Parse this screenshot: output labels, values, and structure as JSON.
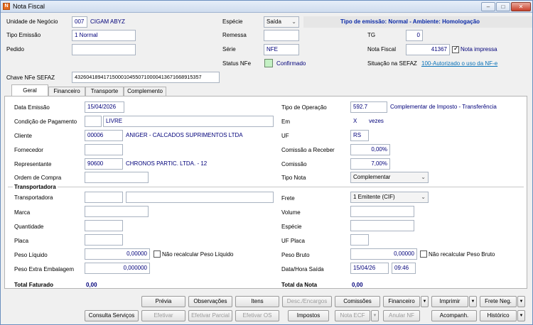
{
  "window": {
    "title": "Nota Fiscal",
    "minimize": "–",
    "maximize": "□",
    "close": "✕",
    "icon_letter": "N"
  },
  "header": {
    "unidade_label": "Unidade de Negócio",
    "unidade_code": "007",
    "unidade_name": "CIGAM ABYZ",
    "especie_label": "Espécie",
    "especie_value": "Saída",
    "tipo_emissao_banner": "Tipo de emissão: Normal - Ambiente: Homologação",
    "tipo_emissao_label": "Tipo Emissão",
    "tipo_emissao_value": "1 Normal",
    "remessa_label": "Remessa",
    "remessa_value": "",
    "tg_label": "TG",
    "tg_value": "0",
    "pedido_label": "Pedido",
    "pedido_value": "",
    "serie_label": "Série",
    "serie_value": "NFE",
    "nota_fiscal_label": "Nota Fiscal",
    "nota_fiscal_value": "41367",
    "nota_impressa_label": "Nota impressa",
    "nota_impressa_checked": true,
    "status_nfe_label": "Status NFe",
    "status_nfe_value": "Confirmado",
    "situacao_label": "Situação na SEFAZ",
    "situacao_value": "100-Autorizado o uso da NF-e",
    "chave_label": "Chave NFe SEFAZ",
    "chave_value": "43260418941715000104550710000413671668915357"
  },
  "tabs": [
    "Geral",
    "Financeiro",
    "Transporte",
    "Complemento"
  ],
  "geral": {
    "data_emissao_label": "Data Emissão",
    "data_emissao_value": "15/04/2026",
    "tipo_operacao_label": "Tipo de Operação",
    "tipo_operacao_code": "592.7",
    "tipo_operacao_desc": "Complementar de Imposto - Transferência",
    "condicao_label": "Condição de Pagamento",
    "condicao_code": "",
    "condicao_value": "LIVRE",
    "em_label": "Em",
    "em_value": "X",
    "vezes_label": "vezes",
    "cliente_label": "Cliente",
    "cliente_code": "00006",
    "cliente_name": "ANIGER - CALCADOS SUPRIMENTOS LTDA",
    "uf_label": "UF",
    "uf_value": "RS",
    "fornecedor_label": "Fornecedor",
    "fornecedor_value": "",
    "comissao_receber_label": "Comissão a Receber",
    "comissao_receber_value": "0,00%",
    "representante_label": "Representante",
    "representante_code": "90600",
    "representante_name": "CHRONOS PARTIC. LTDA. - 12",
    "comissao_label": "Comissão",
    "comissao_value": "7,00%",
    "ordem_compra_label": "Ordem de Compra",
    "ordem_compra_value": "",
    "tipo_nota_label": "Tipo Nota",
    "tipo_nota_value": "Complementar"
  },
  "transportadora": {
    "section_label": "Transportadora",
    "transportadora_label": "Transportadora",
    "transportadora_code": "",
    "transportadora_name": "",
    "frete_label": "Frete",
    "frete_value": "1 Emitente (CIF)",
    "marca_label": "Marca",
    "marca_value": "",
    "volume_label": "Volume",
    "volume_value": "",
    "quantidade_label": "Quantidade",
    "quantidade_value": "",
    "especie_label": "Espécie",
    "especie_value": "",
    "placa_label": "Placa",
    "placa_value": "",
    "uf_placa_label": "UF Placa",
    "uf_placa_value": "",
    "peso_liquido_label": "Peso Líquido",
    "peso_liquido_value": "0,00000",
    "nao_recalc_liq_label": "Não recalcular Peso Líquido",
    "peso_bruto_label": "Peso Bruto",
    "peso_bruto_value": "0,00000",
    "nao_recalc_bruto_label": "Não recalcular Peso Bruto",
    "peso_extra_label": "Peso Extra Embalagem",
    "peso_extra_value": "0,000000",
    "data_hora_saida_label": "Data/Hora Saída",
    "data_saida_value": "15/04/26",
    "hora_saida_value": "09:46"
  },
  "totals": {
    "total_faturado_label": "Total Faturado",
    "total_faturado_value": "0,00",
    "total_nota_label": "Total da Nota",
    "total_nota_value": "0,00"
  },
  "buttons": {
    "previa": "Prévia",
    "observacoes": "Observações",
    "itens": "Itens",
    "desc_encargos": "Desc./Encargos",
    "comissoes": "Comissões",
    "financeiro": "Financeiro",
    "imprimir": "Imprimir",
    "frete_neg": "Frete Neg.",
    "consulta_servicos": "Consulta Serviços",
    "efetivar": "Efetivar",
    "efetivar_parcial": "Efetivar Parcial",
    "efetivar_os": "Efetivar OS",
    "impostos": "Impostos",
    "nota_ecf": "Nota ECF",
    "anular_nf": "Anular NF",
    "acompanh": "Acompanh.",
    "historico": "Histórico",
    "dropdown_arrow": "▼"
  },
  "colors": {
    "accent_blue": "#0b2aa8",
    "link": "#0a72b8",
    "status_green": "#c4f0c4"
  }
}
